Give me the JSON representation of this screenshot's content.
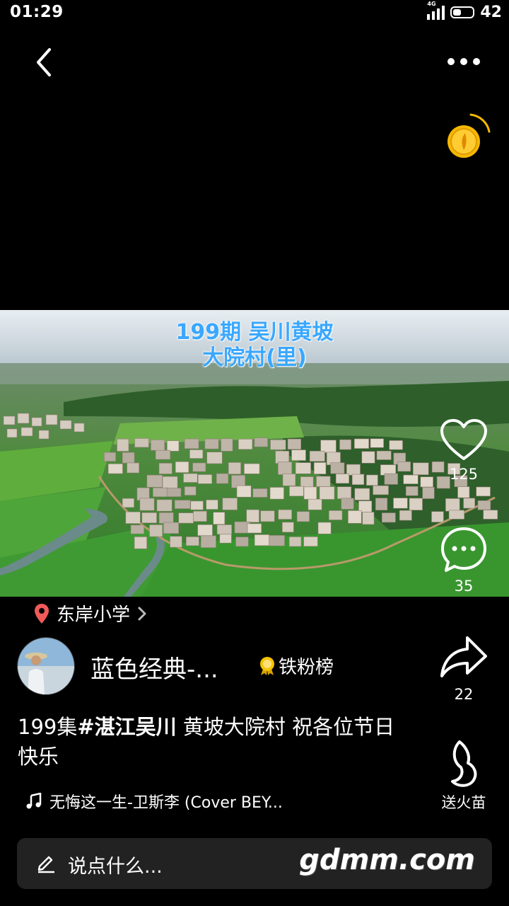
{
  "status_bar": {
    "time": "01:29",
    "network": "4G",
    "battery": "42",
    "battery_fraction": 0.42
  },
  "nav": {
    "back_icon": "chevron-left-icon",
    "more_icon": "more-horizontal-icon",
    "coin_icon": "gold-coin-icon"
  },
  "video": {
    "caption_line1": "199期 吴川黄坡",
    "caption_line2": "大院村(里)"
  },
  "actions": {
    "like_count": "125",
    "comment_count": "35",
    "share_count": "22",
    "gift_label": "送火苗"
  },
  "location": {
    "name": "东岸小学"
  },
  "author": {
    "name": "蓝色经典-...",
    "badge_label": "铁粉榜"
  },
  "description": {
    "prefix": "199集",
    "hashtag": "#湛江吴川",
    "text": " 黄坡大院村 祝各位节日快乐"
  },
  "music": {
    "title": "无悔这一生-卫斯李 (Cover BEY..."
  },
  "comment_input": {
    "placeholder": "说点什么...",
    "watermark": "gdmm.com"
  },
  "colors": {
    "background": "#000000",
    "caption_blue": "#3aa7ff",
    "location_pin": "#f05a5a",
    "coin_gold": "#f5b800"
  }
}
